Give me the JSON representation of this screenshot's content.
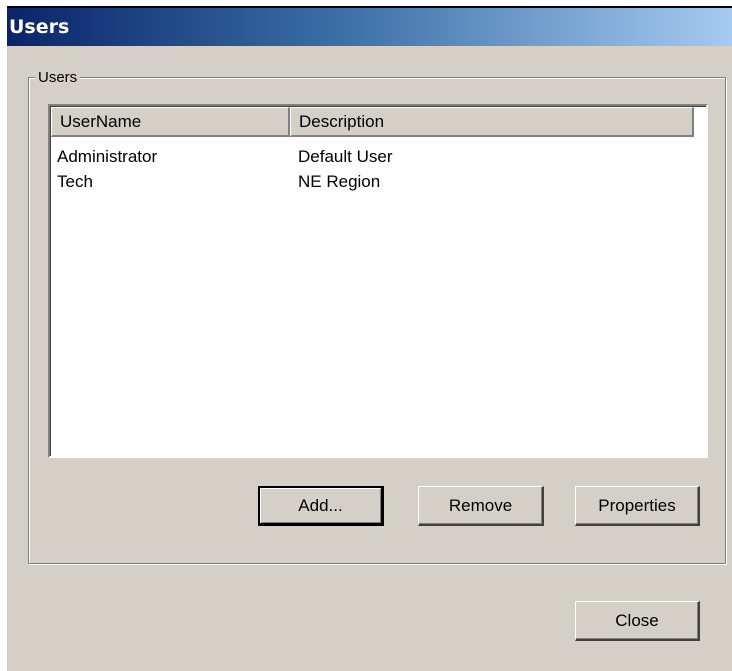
{
  "window": {
    "title": "Users"
  },
  "group": {
    "label": "Users"
  },
  "list": {
    "columns": [
      "UserName",
      "Description"
    ],
    "rows": [
      {
        "username": "Administrator",
        "description": "Default User"
      },
      {
        "username": "Tech",
        "description": "NE Region"
      }
    ]
  },
  "buttons": {
    "add": "Add...",
    "remove": "Remove",
    "properties": "Properties",
    "close": "Close"
  },
  "colors": {
    "titlebar_start": "#0a246a",
    "titlebar_end": "#a6caf0",
    "dialog_face": "#d4d0c8"
  }
}
